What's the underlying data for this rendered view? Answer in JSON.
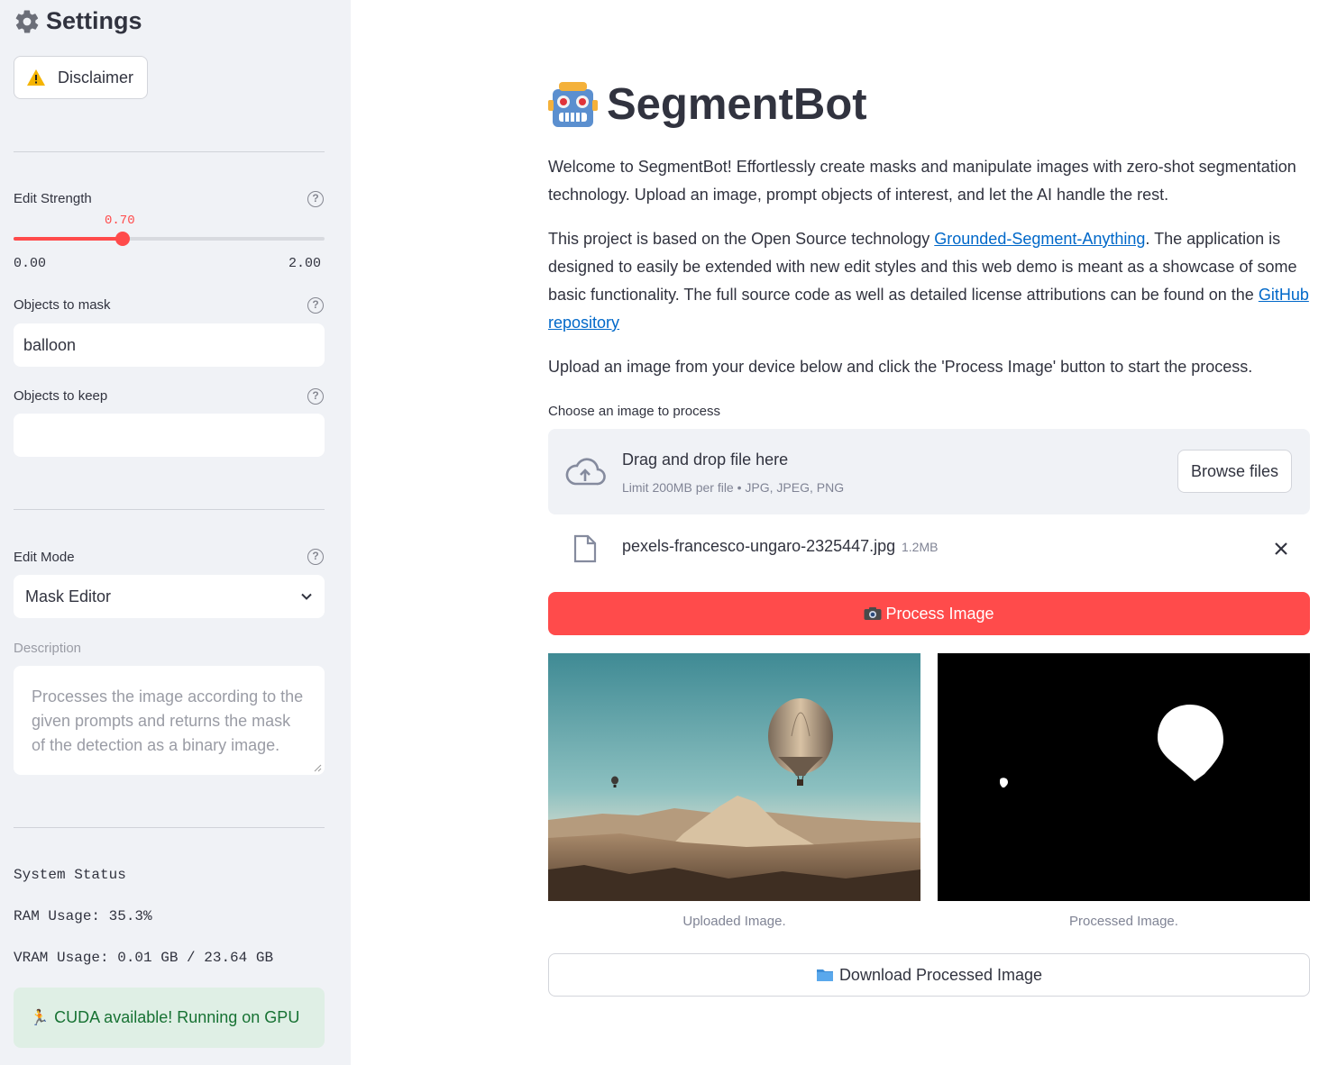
{
  "sidebar": {
    "title": "Settings",
    "disclaimer_label": "Disclaimer",
    "edit_strength": {
      "label": "Edit Strength",
      "value": 0.7,
      "value_text": "0.70",
      "min_text": "0.00",
      "max_text": "2.00",
      "min": 0.0,
      "max": 2.0
    },
    "objects_to_mask": {
      "label": "Objects to mask",
      "value": "balloon"
    },
    "objects_to_keep": {
      "label": "Objects to keep",
      "value": ""
    },
    "edit_mode": {
      "label": "Edit Mode",
      "value": "Mask Editor"
    },
    "description": {
      "label": "Description",
      "placeholder": "Processes the image according to the given prompts and returns the mask of the detection as a binary image."
    },
    "system_status": {
      "title": "System Status",
      "ram": "RAM Usage: 35.3%",
      "vram": "VRAM Usage: 0.01 GB / 23.64 GB"
    },
    "cuda_message": "CUDA available! Running on GPU"
  },
  "main": {
    "title": "SegmentBot",
    "intro": "Welcome to SegmentBot! Effortlessly create masks and manipulate images with zero-shot segmentation technology. Upload an image, prompt objects of interest, and let the AI handle the rest.",
    "about": {
      "before": "This project is based on the Open Source technology ",
      "link1": "Grounded-Segment-Anything",
      "middle": ". The application is designed to easily be extended with new edit styles and this web demo is meant as a showcase of some basic functionality. The full source code as well as detailed license attributions can be found on the ",
      "link2": "GitHub repository"
    },
    "instructions": "Upload an image from your device below and click the 'Process Image' button to start the process.",
    "uploader": {
      "label": "Choose an image to process",
      "drag_text": "Drag and drop file here",
      "limit_text": "Limit 200MB per file • JPG, JPEG, PNG",
      "browse_label": "Browse files"
    },
    "file": {
      "name": "pexels-francesco-ungaro-2325447.jpg",
      "size": "1.2MB"
    },
    "process_label": "Process Image",
    "captions": {
      "uploaded": "Uploaded Image.",
      "processed": "Processed Image."
    },
    "download_label": "Download Processed Image"
  },
  "colors": {
    "primary": "#ff4b4b",
    "sidebar_bg": "#f0f2f6",
    "link": "#0068c9",
    "success_bg": "#dfefe5",
    "success_text": "#177233"
  },
  "icons": [
    "gear-icon",
    "warning-icon",
    "help-icon",
    "chevron-down-icon",
    "robot-icon",
    "cloud-upload-icon",
    "file-icon",
    "close-icon",
    "camera-icon",
    "folder-icon",
    "runner-icon"
  ]
}
